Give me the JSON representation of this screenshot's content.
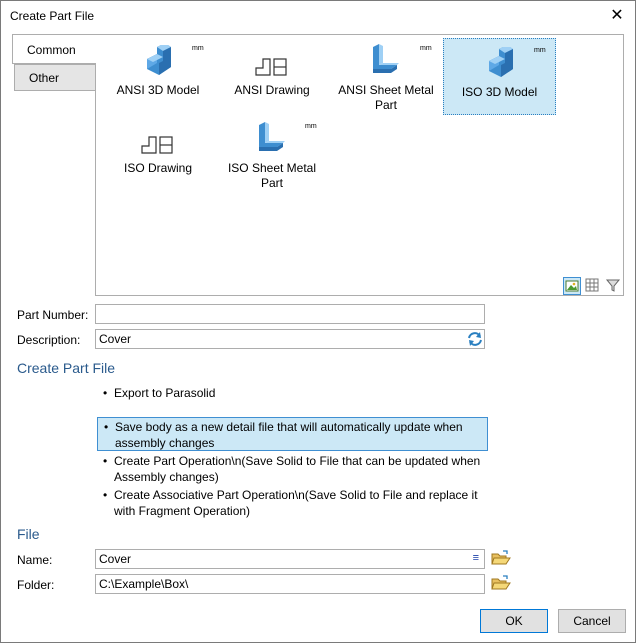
{
  "window": {
    "title": "Create Part File"
  },
  "tabs": [
    {
      "label": "Common"
    },
    {
      "label": "Other"
    }
  ],
  "templates": [
    {
      "label": "ANSI 3D Model",
      "icon": "3d-model-icon",
      "unit": "mm"
    },
    {
      "label": "ANSI Drawing",
      "icon": "drawing-icon"
    },
    {
      "label": "ANSI Sheet Metal Part",
      "icon": "sheet-metal-icon",
      "unit": "mm"
    },
    {
      "label": "ISO 3D Model",
      "icon": "3d-model-icon",
      "unit": "mm",
      "selected": true
    },
    {
      "label": "ISO Drawing",
      "icon": "drawing-icon"
    },
    {
      "label": "ISO Sheet Metal Part",
      "icon": "sheet-metal-icon",
      "unit": "mm"
    }
  ],
  "view_icons": [
    "large-icons-view-icon",
    "grid-view-icon",
    "filter-icon"
  ],
  "form": {
    "part_number_label": "Part Number:",
    "part_number_value": "",
    "description_label": "Description:",
    "description_value": "Cover"
  },
  "section_create": "Create Part File",
  "options": [
    {
      "text": "Export to Parasolid",
      "selected": false
    },
    {
      "text": "Save body as a new detail file that will automatically update when assembly changes",
      "selected": true
    },
    {
      "text": "Create Part Operation\\n(Save Solid to File that can be  updated when Assembly changes)",
      "selected": false
    },
    {
      "text": "Create Associative Part Operation\\n(Save Solid to File and replace it with Fragment Operation)",
      "selected": false
    }
  ],
  "section_file": "File",
  "file": {
    "name_label": "Name:",
    "name_value": "Cover",
    "folder_label": "Folder:",
    "folder_value": "C:\\Example\\Box\\"
  },
  "buttons": {
    "ok": "OK",
    "cancel": "Cancel"
  },
  "colors": {
    "accent": "#2a5a8c",
    "selection": "#cce8f6",
    "icon_blue": "#3e8ed0"
  }
}
